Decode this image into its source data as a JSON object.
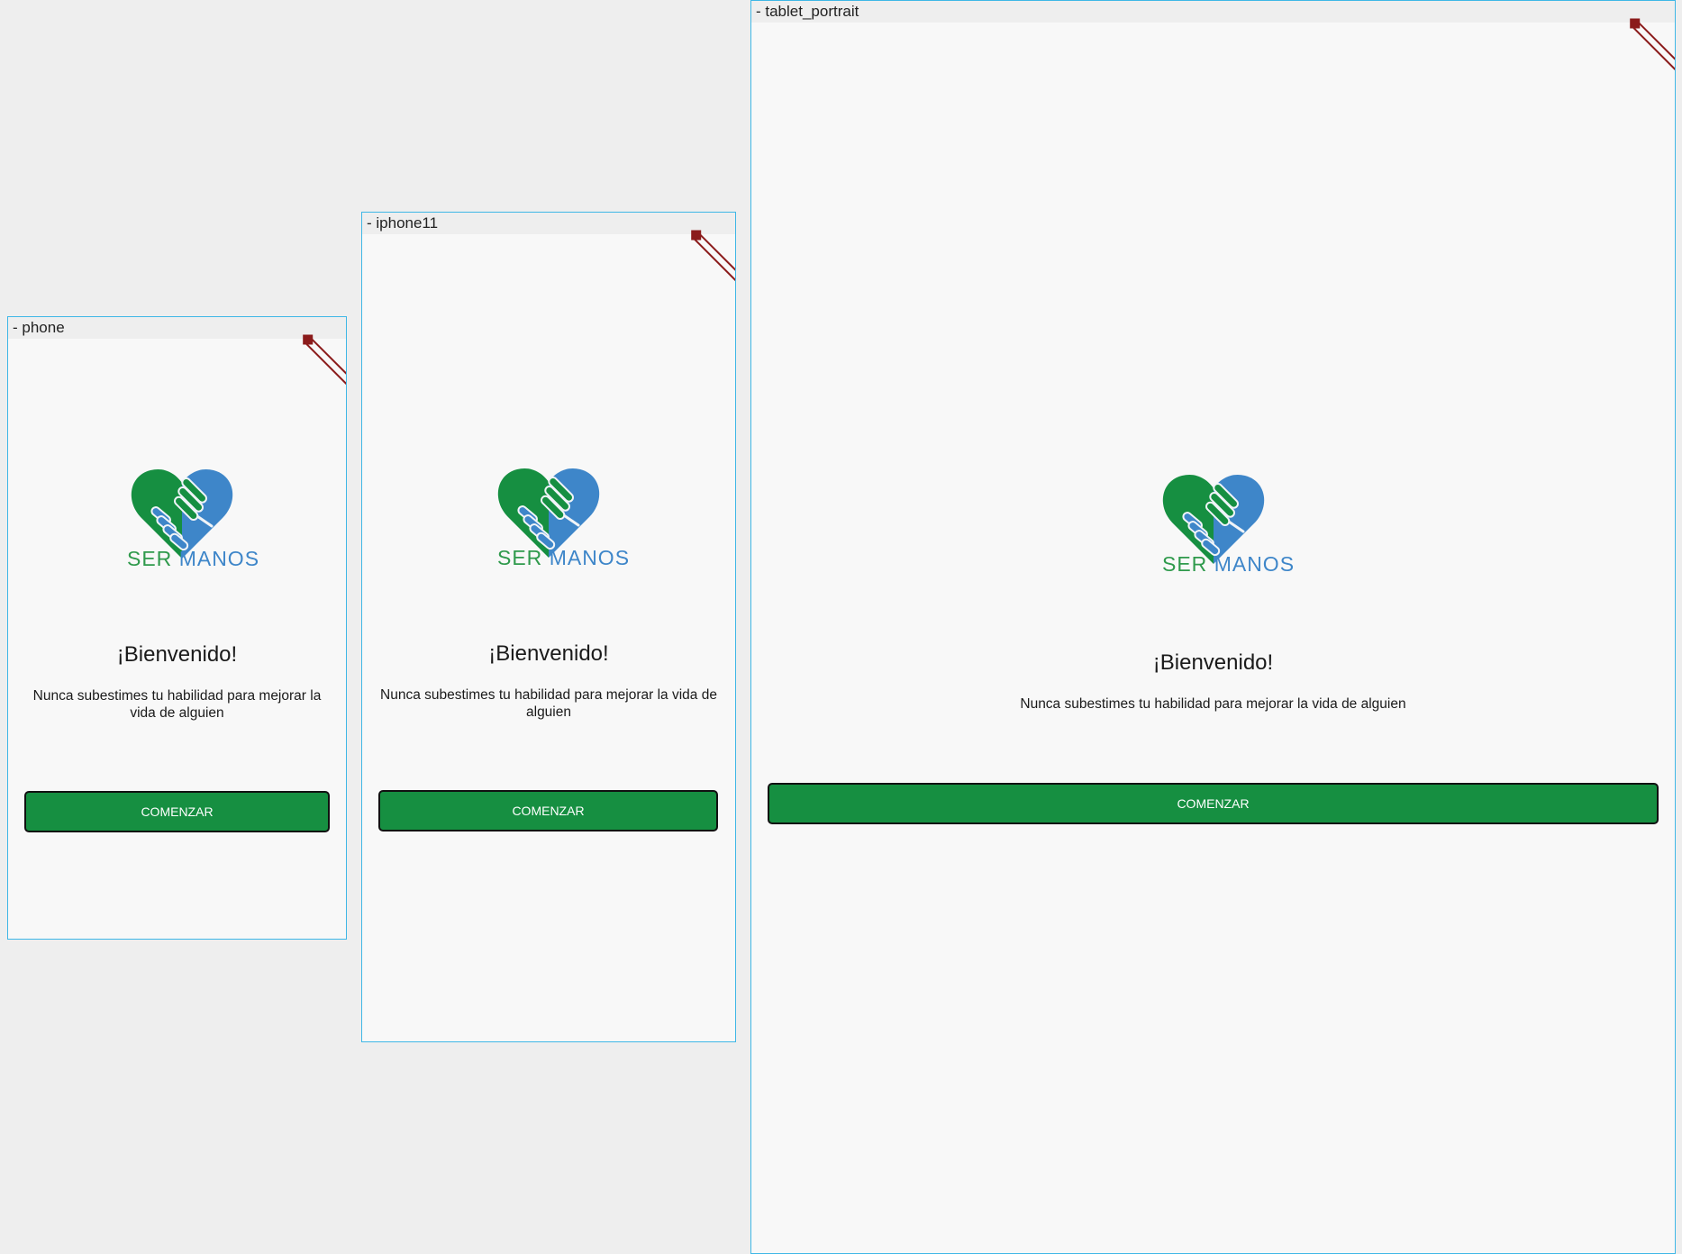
{
  "colors": {
    "background": "#eeeeee",
    "screen": "#f8f8f8",
    "frame_border": "#3fb7e6",
    "primary_green": "#168f41",
    "logo_green": "#2f9a4c",
    "logo_blue": "#3e86c9",
    "debug_banner": "#8b1b1b"
  },
  "frames": {
    "phone": {
      "label": "- phone",
      "brand": {
        "ser": "SER",
        "manos": "MANOS"
      },
      "welcome": "¡Bienvenido!",
      "subtitle": "Nunca subestimes tu habilidad para mejorar la vida de alguien",
      "cta": "COMENZAR"
    },
    "iphone11": {
      "label": "- iphone11",
      "brand": {
        "ser": "SER",
        "manos": "MANOS"
      },
      "welcome": "¡Bienvenido!",
      "subtitle": "Nunca subestimes tu habilidad para mejorar la vida de alguien",
      "cta": "COMENZAR"
    },
    "tablet_portrait": {
      "label": "- tablet_portrait",
      "brand": {
        "ser": "SER",
        "manos": "MANOS"
      },
      "welcome": "¡Bienvenido!",
      "subtitle": "Nunca subestimes tu habilidad para mejorar la vida de alguien",
      "cta": "COMENZAR"
    }
  },
  "icons": {
    "logo": "heart-handshake-icon",
    "debug_banner": "debug-banner-icon"
  }
}
